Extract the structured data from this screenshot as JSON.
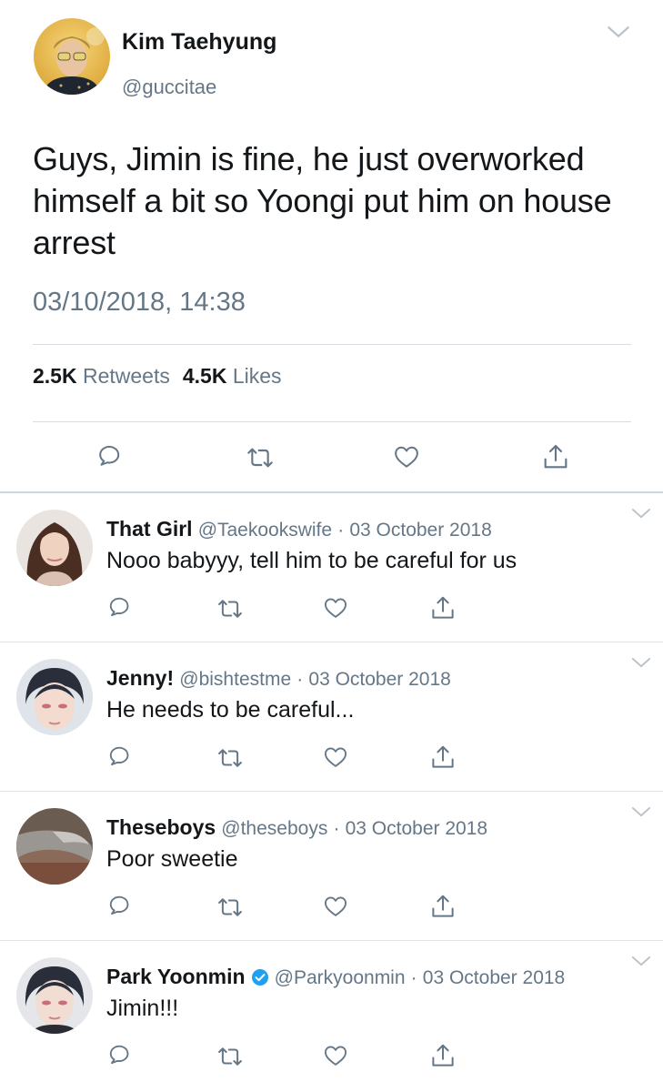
{
  "colors": {
    "text": "#14171a",
    "secondary": "#657786",
    "icon": "#657786",
    "divider": "#e1e8ed",
    "verified": "#1da1f2"
  },
  "main_tweet": {
    "display_name": "Kim Taehyung",
    "handle": "@guccitae",
    "text": "Guys, Jimin is fine, he just overworked himself a bit so Yoongi put him on house arrest",
    "timestamp": "03/10/2018, 14:38",
    "retweets_count": "2.5K",
    "retweets_label": "Retweets",
    "likes_count": "4.5K",
    "likes_label": "Likes",
    "actions": [
      "reply-icon",
      "retweet-icon",
      "like-icon",
      "share-icon"
    ]
  },
  "replies": [
    {
      "display_name": "That Girl",
      "handle": "@Taekookswife",
      "separator": "·",
      "date": "03 October 2018",
      "text": "Nooo babyyy, tell him to be careful for us",
      "verified": false
    },
    {
      "display_name": "Jenny!",
      "handle": "@bishtestme",
      "separator": "·",
      "date": "03 October 2018",
      "text": "He needs to be careful...",
      "verified": false
    },
    {
      "display_name": "Theseboys",
      "handle": "@theseboys",
      "separator": "·",
      "date": "03 October 2018",
      "text": "Poor sweetie",
      "verified": false
    },
    {
      "display_name": "Park Yoonmin",
      "handle": "@Parkyoonmin",
      "separator": "·",
      "date": "03 October 2018",
      "text": "Jimin!!!",
      "verified": true
    }
  ]
}
